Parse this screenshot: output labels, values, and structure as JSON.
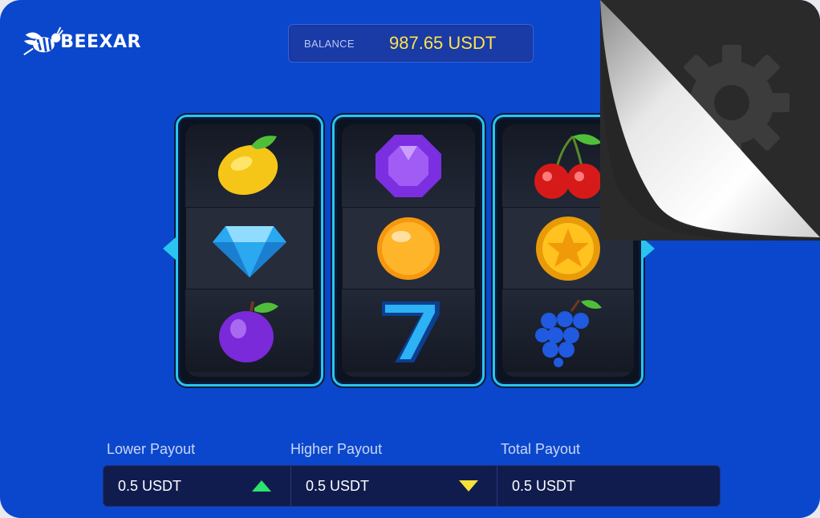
{
  "brand": {
    "name": "BEEXAR"
  },
  "balance": {
    "label": "BALANCE",
    "value": "987.65 USDT"
  },
  "reels": [
    {
      "symbols": [
        "lemon-icon",
        "diamond-icon",
        "plum-icon"
      ]
    },
    {
      "symbols": [
        "purple-gem-icon",
        "orange-icon",
        "seven-icon"
      ]
    },
    {
      "symbols": [
        "cherries-icon",
        "star-coin-icon",
        "grapes-icon"
      ]
    }
  ],
  "payouts": {
    "lower": {
      "label": "Lower Payout",
      "value": "0.5 USDT",
      "icon": "arrow-up-icon"
    },
    "higher": {
      "label": "Higher Payout",
      "value": "0.5 USDT",
      "icon": "arrow-down-icon"
    },
    "total": {
      "label": "Total Payout",
      "value": "0.5 USDT"
    }
  },
  "overlay": {
    "icon": "gear-icon"
  },
  "colors": {
    "background": "#0a47cc",
    "reel_border": "#29c5f0",
    "balance_value": "#ffe34a",
    "up": "#2de36c",
    "down": "#f6e23a"
  }
}
